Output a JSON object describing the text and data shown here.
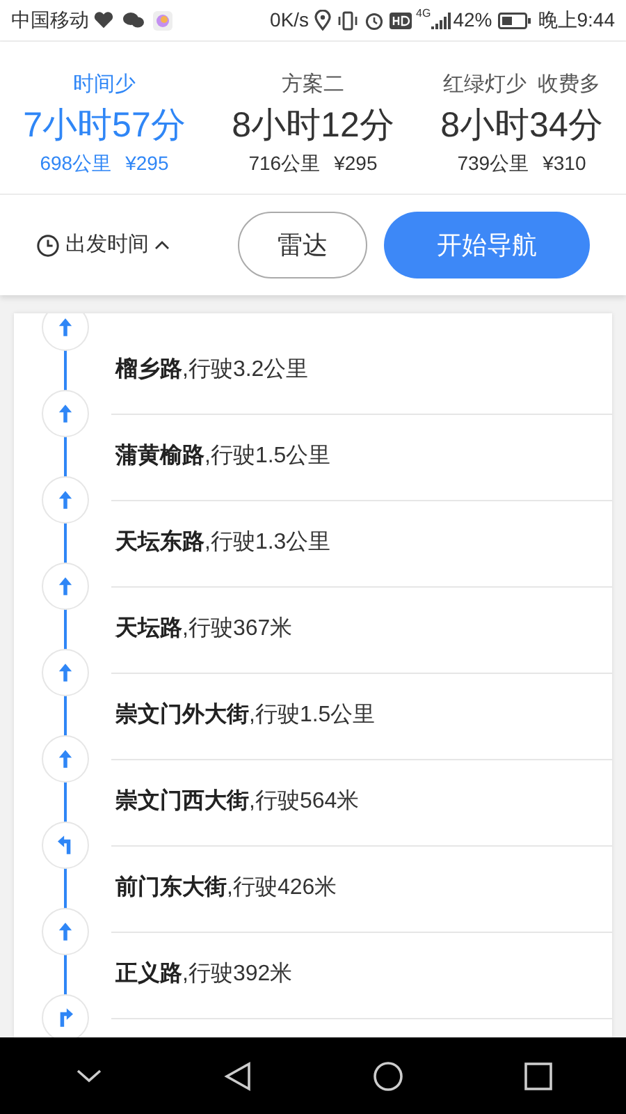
{
  "status_bar": {
    "carrier": "中国移动",
    "speed": "0K/s",
    "network": "4G",
    "battery": "42%",
    "time": "晚上9:44"
  },
  "routes": [
    {
      "label": "时间少",
      "duration": "7小时57分",
      "distance": "698公里",
      "toll": "¥295",
      "selected": true
    },
    {
      "label": "方案二",
      "duration": "8小时12分",
      "distance": "716公里",
      "toll": "¥295",
      "selected": false
    },
    {
      "label": "红绿灯少  收费多",
      "duration": "8小时34分",
      "distance": "739公里",
      "toll": "¥310",
      "selected": false
    }
  ],
  "departure": {
    "label": "出发时间",
    "expanded": false
  },
  "buttons": [
    {
      "label": "雷达",
      "kind": "outline"
    },
    {
      "label": "开始导航",
      "kind": "primary"
    }
  ],
  "steps": [
    {
      "kind": "straight",
      "text": "**榴乡路**,行驶3.2公里"
    },
    {
      "kind": "straight",
      "text": "**蒲黄榆路**,行驶1.5公里"
    },
    {
      "kind": "straight",
      "text": "**天坛东路**,行驶1.3公里"
    },
    {
      "kind": "straight",
      "text": "**天坛路**,行驶367米"
    },
    {
      "kind": "straight",
      "text": "**崇文门外大街**,行驶1.5公里"
    },
    {
      "kind": "straight",
      "text": "**崇文门西大街**,行驶564米"
    },
    {
      "kind": "left",
      "text": "**前门东大街**,行驶426米"
    },
    {
      "kind": "straight",
      "text": "**正义路**,行驶392米"
    },
    {
      "kind": "right"
    }
  ]
}
